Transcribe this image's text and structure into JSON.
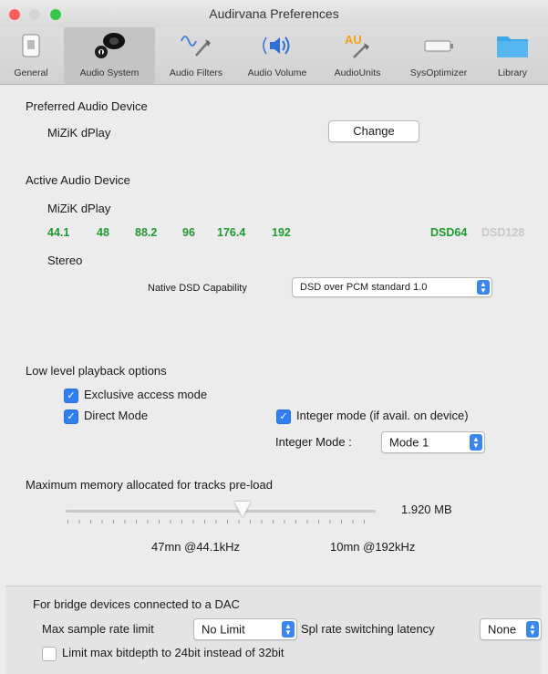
{
  "window": {
    "title": "Audirvana Preferences"
  },
  "toolbar": {
    "items": [
      {
        "label": "General",
        "icon": "switch-icon"
      },
      {
        "label": "Audio System",
        "icon": "speaker-icon"
      },
      {
        "label": "Audio Filters",
        "icon": "waveform-icon"
      },
      {
        "label": "Audio Volume",
        "icon": "volume-icon"
      },
      {
        "label": "AudioUnits",
        "icon": "au-icon",
        "badge": "AU"
      },
      {
        "label": "SysOptimizer",
        "icon": "battery-icon"
      },
      {
        "label": "Library",
        "icon": "folder-icon"
      }
    ],
    "selected": "Audio System"
  },
  "preferred": {
    "heading": "Preferred Audio Device",
    "device": "MiZiK dPlay",
    "change_label": "Change"
  },
  "active": {
    "heading": "Active Audio Device",
    "device": "MiZiK dPlay",
    "rates": [
      "44.1",
      "48",
      "88.2",
      "96",
      "176.4",
      "192"
    ],
    "dsd64": "DSD64",
    "dsd128": "DSD128",
    "channels": "Stereo",
    "dsd_label": "Native DSD Capability",
    "dsd_value": "DSD over PCM standard 1.0"
  },
  "playback": {
    "heading": "Low level playback options",
    "exclusive": "Exclusive access mode",
    "direct": "Direct Mode",
    "integer": "Integer mode (if avail. on device)",
    "integer_mode_label": "Integer Mode :",
    "integer_mode_value": "Mode 1"
  },
  "memory": {
    "heading": "Maximum memory allocated for tracks pre-load",
    "value": "1.920 MB",
    "left_note": "47mn @44.1kHz",
    "right_note": "10mn @192kHz",
    "slider_fraction": 0.57
  },
  "bridge": {
    "heading": "For bridge devices connected to a DAC",
    "max_rate_label": "Max sample rate limit",
    "max_rate_value": "No Limit",
    "latency_label": "Spl rate switching latency",
    "latency_value": "None",
    "bitdepth_label": "Limit max bitdepth to 24bit instead of 32bit"
  },
  "colors": {
    "accent": "#2f7ff0",
    "green": "#1f9a2d",
    "disabled": "#c9c9c9"
  }
}
